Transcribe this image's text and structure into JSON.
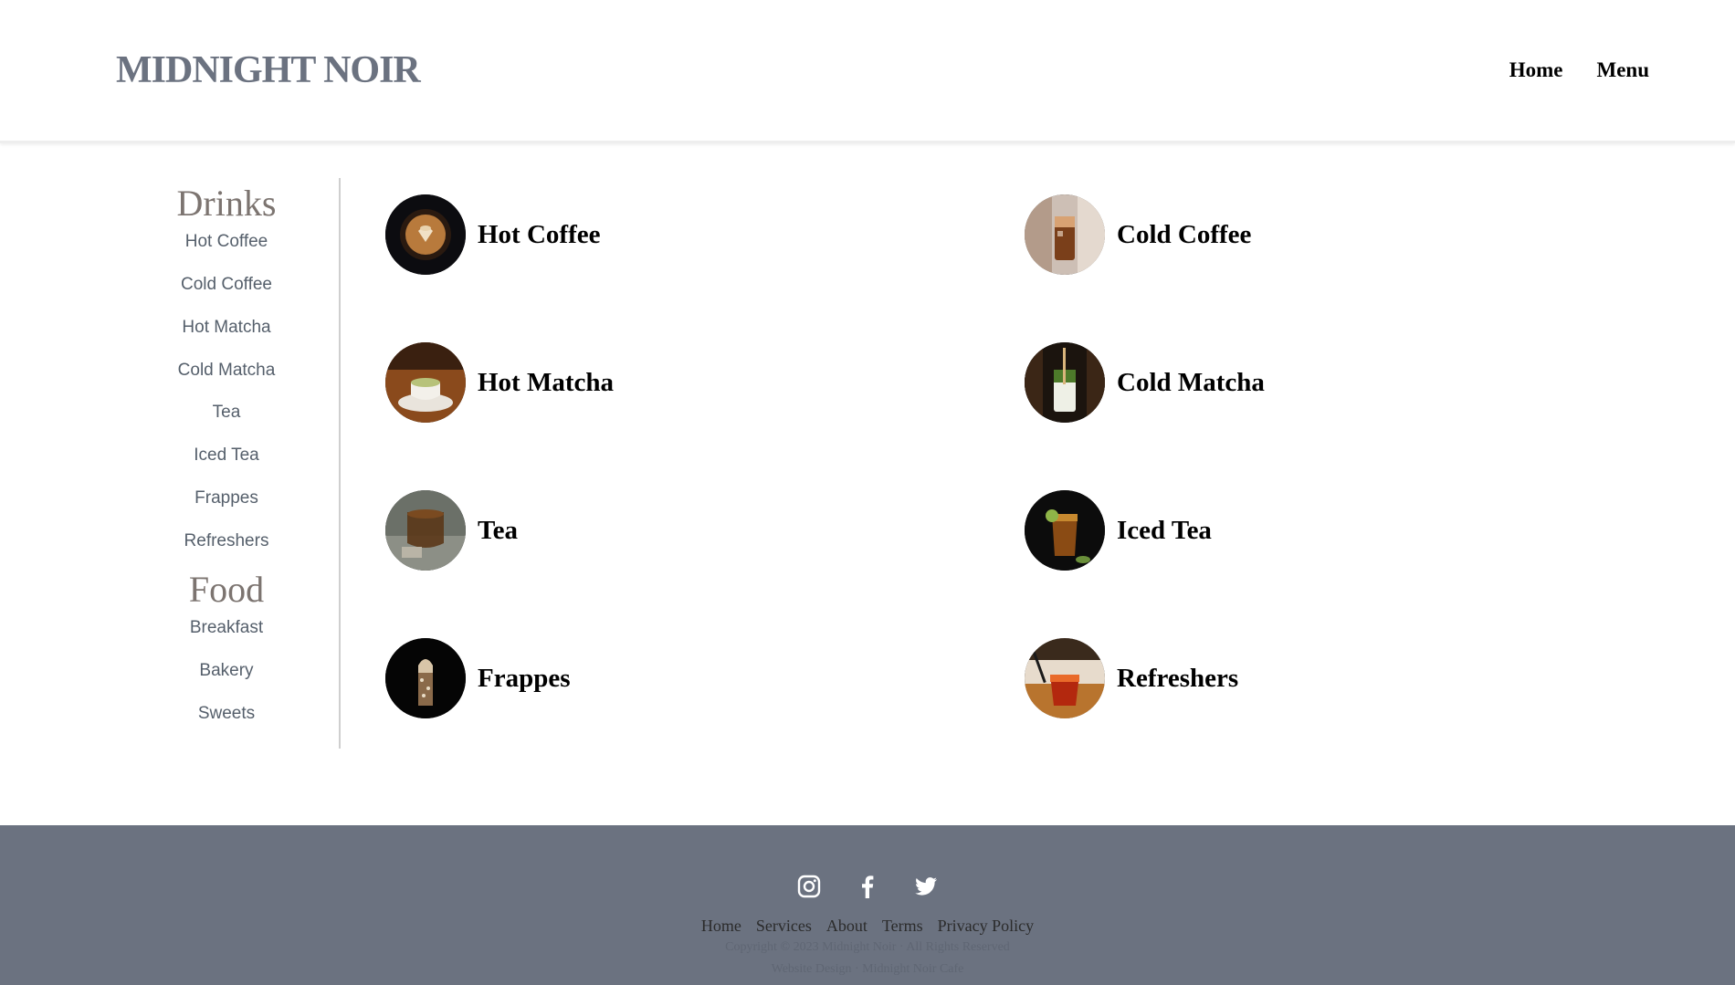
{
  "header": {
    "logo": "MIDNIGHT NOIR",
    "nav": [
      "Home",
      "Menu"
    ]
  },
  "sidebar": {
    "drinks_heading": "Drinks",
    "drinks": [
      "Hot Coffee",
      "Cold Coffee",
      "Hot Matcha",
      "Cold Matcha",
      "Tea",
      "Iced Tea",
      "Frappes",
      "Refreshers"
    ],
    "food_heading": "Food",
    "food": [
      "Breakfast",
      "Bakery",
      "Sweets"
    ]
  },
  "menu": [
    {
      "label": "Hot Coffee",
      "icon": "hot-coffee-photo"
    },
    {
      "label": "Cold Coffee",
      "icon": "cold-coffee-photo"
    },
    {
      "label": "Hot Matcha",
      "icon": "hot-matcha-photo"
    },
    {
      "label": "Cold Matcha",
      "icon": "cold-matcha-photo"
    },
    {
      "label": "Tea",
      "icon": "tea-photo"
    },
    {
      "label": "Iced Tea",
      "icon": "iced-tea-photo"
    },
    {
      "label": "Frappes",
      "icon": "frappe-photo"
    },
    {
      "label": "Refreshers",
      "icon": "refresher-photo"
    }
  ],
  "footer": {
    "socials": [
      "instagram-icon",
      "facebook-icon",
      "twitter-icon"
    ],
    "links": [
      "Home",
      "Services",
      "About",
      "Terms",
      "Privacy Policy"
    ],
    "copyright": "Copyright © 2023 Midnight Noir · All Rights Reserved",
    "credit": "Website Design · Midnight Noir Cafe"
  },
  "colors": {
    "footer_bg": "#6b7280",
    "logo": "#6b7280",
    "sidebar_heading": "#7c7470",
    "sidebar_link": "#555f6b"
  }
}
